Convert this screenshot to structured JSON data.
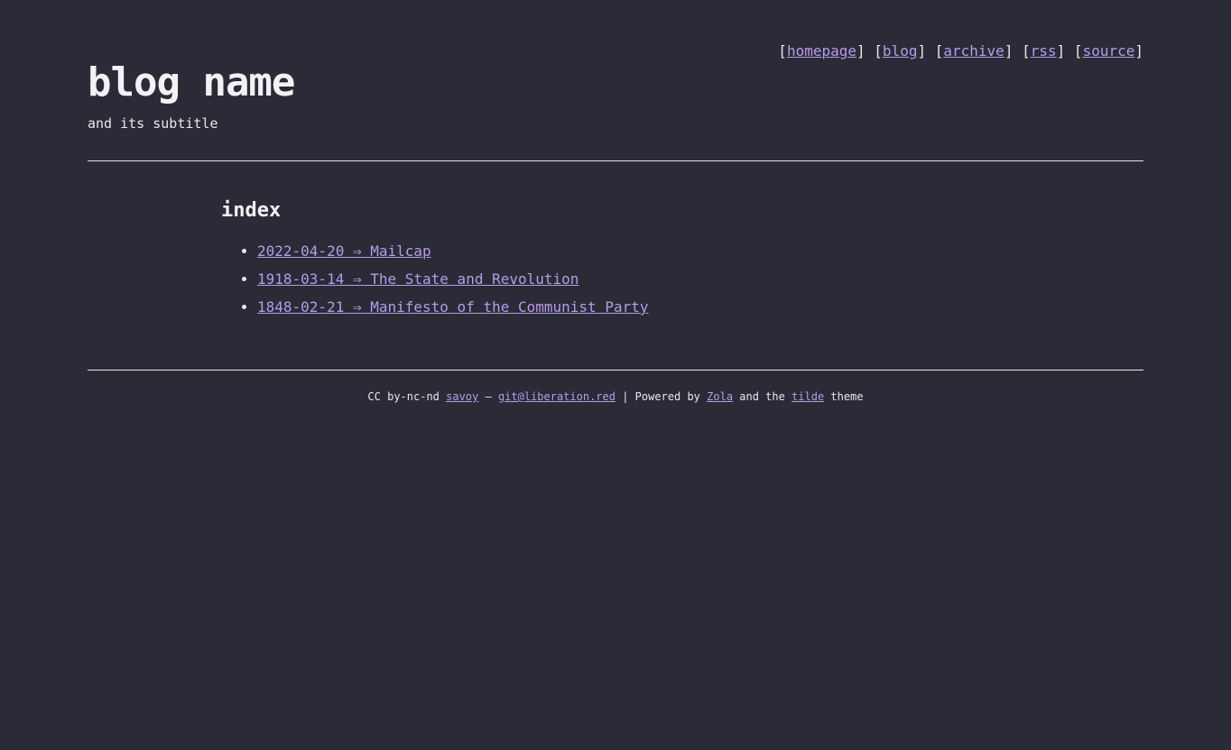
{
  "header": {
    "title": "blog name",
    "subtitle": "and its subtitle"
  },
  "nav": {
    "items": [
      {
        "label": "homepage"
      },
      {
        "label": "blog"
      },
      {
        "label": "archive"
      },
      {
        "label": "rss"
      },
      {
        "label": "source"
      }
    ],
    "open_bracket": "[",
    "close_bracket": "]"
  },
  "main": {
    "section_title": "index",
    "posts": [
      {
        "label": "2022-04-20 ⇒ Mailcap"
      },
      {
        "label": "1918-03-14 ⇒ The State and Revolution"
      },
      {
        "label": "1848-02-21 ⇒ Manifesto of the Communist Party"
      }
    ]
  },
  "footer": {
    "license_text": "CC by-nc-nd ",
    "author_link": "savoy",
    "dash": " — ",
    "email_link": "git@liberation.red",
    "powered_text": " | Powered by ",
    "zola_link": "Zola",
    "and_the_text": " and the ",
    "theme_link": "tilde",
    "theme_text": " theme"
  },
  "colors": {
    "background": "#2a2b36",
    "text": "#e8e8ec",
    "link": "#b79bea"
  }
}
